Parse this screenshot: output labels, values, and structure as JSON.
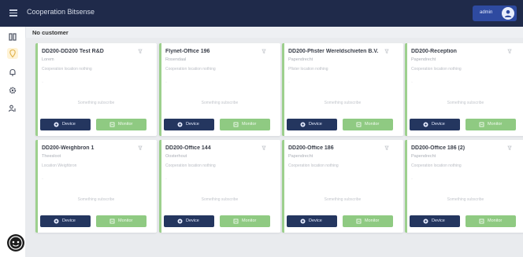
{
  "header": {
    "title": "Cooperation Bitsense",
    "user_label": "admin"
  },
  "sidebar": {
    "items": [
      {
        "icon": "grid-icon",
        "active": false
      },
      {
        "icon": "location-icon",
        "active": true
      },
      {
        "icon": "bell-icon",
        "active": false
      },
      {
        "icon": "gear-icon",
        "active": false
      },
      {
        "icon": "users-icon",
        "active": false
      }
    ]
  },
  "main": {
    "section_title": "No customer",
    "cards": [
      {
        "title": "DD200-DD200 Test R&D",
        "subtitle": "Lorem",
        "description": "Cooperation location nothing",
        "status": "Something subscribe",
        "device_label": "Device",
        "monitor_label": "Monitor"
      },
      {
        "title": "Flynet-Office 196",
        "subtitle": "Rosendaal",
        "description": "Cooperation location nothing",
        "status": "Something subscribe",
        "device_label": "Device",
        "monitor_label": "Monitor"
      },
      {
        "title": "DD200-Pfister Wereldschieten B.V.",
        "subtitle": "Papendrecht",
        "description": "Pfister location nothing",
        "status": "Something subscribe",
        "device_label": "Device",
        "monitor_label": "Monitor"
      },
      {
        "title": "DD200-Reception",
        "subtitle": "Papendrecht",
        "description": "Cooperation location nothing",
        "status": "Something subscribe",
        "device_label": "Device",
        "monitor_label": "Monitor"
      },
      {
        "title": "DD200-Weighbron 1",
        "subtitle": "Theesloot",
        "description": "Location Weighbron",
        "status": "Something subscribe",
        "device_label": "Device",
        "monitor_label": "Monitor"
      },
      {
        "title": "DD200-Office 144",
        "subtitle": "Oosterhout",
        "description": "Cooperation location nothing",
        "status": "Something subscribe",
        "device_label": "Device",
        "monitor_label": "Monitor"
      },
      {
        "title": "DD200-Office 186",
        "subtitle": "Papendrecht",
        "description": "Cooperation location nothing",
        "status": "Something subscribe",
        "device_label": "Device",
        "monitor_label": "Monitor"
      },
      {
        "title": "DD200-Office 186 (2)",
        "subtitle": "Papendrecht",
        "description": "Cooperation location nothing",
        "status": "Something subscribe",
        "device_label": "Device",
        "monitor_label": "Monitor"
      }
    ]
  },
  "colors": {
    "topbar": "#1f2a4a",
    "device_button": "#24365f",
    "monitor_button": "#8fca82",
    "card_accent": "#9dd08d",
    "user_chip": "#2e4aa0"
  }
}
